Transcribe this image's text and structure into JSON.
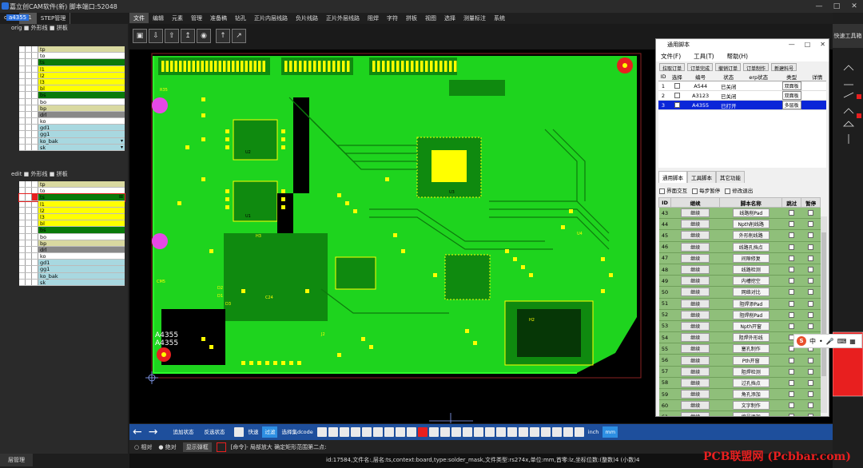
{
  "window": {
    "title": "嘉立创CAM软件(新) 脚本端口:52048",
    "controls": [
      "—",
      "□",
      "✕"
    ]
  },
  "left_panel": {
    "tabs": [
      "orig",
      "+1",
      "STEP管理"
    ],
    "step_name": "a4355",
    "orig_group": {
      "label": "orig",
      "options": [
        "外形线",
        "拼板"
      ]
    },
    "edit_group": {
      "label": "edit",
      "options": [
        "外形线",
        "拼板"
      ]
    },
    "orig_layers": [
      {
        "name": "tp",
        "color": "#d9d9a0"
      },
      {
        "name": "to",
        "color": "#ffffff"
      },
      {
        "name": "ts",
        "color": "#0a7a0a"
      },
      {
        "name": "l1",
        "color": "#ffff00"
      },
      {
        "name": "l2",
        "color": "#ffff00"
      },
      {
        "name": "l3",
        "color": "#ffff00"
      },
      {
        "name": "bl",
        "color": "#ffff00"
      },
      {
        "name": "bs",
        "color": "#0a7a0a"
      },
      {
        "name": "bo",
        "color": "#ffffff"
      },
      {
        "name": "bp",
        "color": "#d9d9a0"
      },
      {
        "name": "drl",
        "color": "#888888"
      },
      {
        "name": "ko",
        "color": "#ffffff"
      },
      {
        "name": "gd1",
        "color": "#a8d8e0"
      },
      {
        "name": "gg1",
        "color": "#a8d8e0"
      },
      {
        "name": "ko_bak",
        "color": "#a8d8e0",
        "dropdown": true
      },
      {
        "name": "sk",
        "color": "#a8d8e0",
        "dropdown": true
      }
    ],
    "edit_layers": [
      {
        "name": "tp",
        "color": "#d9d9a0"
      },
      {
        "name": "to",
        "color": "#ffffff"
      },
      {
        "name": "ts",
        "color": "#0a7a0a",
        "selected": true
      },
      {
        "name": "l1",
        "color": "#ffff00"
      },
      {
        "name": "l2",
        "color": "#ffff00"
      },
      {
        "name": "l3",
        "color": "#ffff00"
      },
      {
        "name": "bl",
        "color": "#ffff00"
      },
      {
        "name": "bs",
        "color": "#0a7a0a"
      },
      {
        "name": "bo",
        "color": "#ffffff"
      },
      {
        "name": "bp",
        "color": "#d9d9a0"
      },
      {
        "name": "drl",
        "color": "#888888"
      },
      {
        "name": "ko",
        "color": "#ffffff"
      },
      {
        "name": "gd1",
        "color": "#a8d8e0"
      },
      {
        "name": "gg1",
        "color": "#a8d8e0"
      },
      {
        "name": "ko_bak",
        "color": "#a8d8e0"
      },
      {
        "name": "sk",
        "color": "#a8d8e0"
      }
    ],
    "bottom_tab": "层管理"
  },
  "menu": [
    "文件",
    "编辑",
    "元素",
    "管理",
    "准备稿",
    "钻孔",
    "正片内层线路",
    "负片线路",
    "正片外层线路",
    "阻焊",
    "字符",
    "拼板",
    "视图",
    "选择",
    "测量标注",
    "系统"
  ],
  "quick_toolbar": "快速工具箱",
  "pcb": {
    "labels": [
      "A4355",
      "A4355",
      "R35",
      "H3",
      "U2",
      "U1",
      "U3",
      "C24",
      "J2",
      "CM5",
      "D1",
      "D2",
      "D3",
      "H2",
      "U4"
    ]
  },
  "dialog": {
    "title": "通用脚本",
    "menu": [
      "文件(F)",
      "工具(T)",
      "帮助(H)"
    ],
    "buttons": [
      "拉取订单",
      "订单完成",
      "撤销订单",
      "订单制作",
      "新建料号"
    ],
    "orders_header": [
      "ID",
      "选择",
      "编号",
      "状态",
      "erp状态",
      "类型",
      "详情"
    ],
    "orders": [
      {
        "id": "1",
        "code": "A544",
        "status": "已关闭",
        "erp": "",
        "type": "双面板"
      },
      {
        "id": "2",
        "code": "A3123",
        "status": "已关闭",
        "erp": "",
        "type": "双面板"
      },
      {
        "id": "3",
        "code": "A4355",
        "status": "已打开",
        "erp": "",
        "type": "多层板",
        "selected": true
      }
    ],
    "tabs": [
      "通用脚本",
      "工具脚本",
      "其它功能"
    ],
    "options": [
      "界面交互",
      "每步暂停",
      "修改退出"
    ],
    "steps_header": [
      "ID",
      "继续",
      "脚本名称",
      "跳过",
      "暂停"
    ],
    "steps": [
      {
        "id": "43",
        "btn": "继续",
        "name": "线路削Pad"
      },
      {
        "id": "44",
        "btn": "继续",
        "name": "Npth削线路"
      },
      {
        "id": "45",
        "btn": "继续",
        "name": "外形削线路"
      },
      {
        "id": "46",
        "btn": "继续",
        "name": "线路孔挡点"
      },
      {
        "id": "47",
        "btn": "继续",
        "name": "间隙修复"
      },
      {
        "id": "48",
        "btn": "继续",
        "name": "线路检测"
      },
      {
        "id": "49",
        "btn": "继续",
        "name": "内槽挖空"
      },
      {
        "id": "50",
        "btn": "继续",
        "name": "网络对比"
      },
      {
        "id": "51",
        "btn": "继续",
        "name": "阻焊添Pad"
      },
      {
        "id": "52",
        "btn": "继续",
        "name": "阻焊削Pad"
      },
      {
        "id": "53",
        "btn": "继续",
        "name": "Npth开窗"
      },
      {
        "id": "54",
        "btn": "继续",
        "name": "阻焊外形线"
      },
      {
        "id": "55",
        "btn": "继续",
        "name": "塞孔制作"
      },
      {
        "id": "56",
        "btn": "继续",
        "name": "Pth开窗"
      },
      {
        "id": "57",
        "btn": "继续",
        "name": "阻焊检测"
      },
      {
        "id": "58",
        "btn": "继续",
        "name": "过孔挡点"
      },
      {
        "id": "59",
        "btn": "继续",
        "name": "角孔添加"
      },
      {
        "id": "60",
        "btn": "继续",
        "name": "文字制作"
      },
      {
        "id": "61",
        "btn": "继续",
        "name": "编号添加"
      }
    ]
  },
  "bottom_toolbar": {
    "buttons": [
      "追加状态",
      "反选状态",
      "快速",
      "过滤",
      "选择集dcode",
      "inch",
      "mm"
    ],
    "highlight": "过滤"
  },
  "status": {
    "coord_modes": [
      "相对",
      "绝对"
    ],
    "show_btn": "显示弹框",
    "command": "[命令]- 局部放大 确定矩形范围第二点:",
    "info": "id:17584,文件名:,层名:ts,context:board,type:solder_mask,文件类型:rs274x,单位:mm,首零:lz,坐标位数:(整数)4 (小数)4"
  },
  "watermark": "PCB联盟网 (Pcbbar.com)",
  "ime": {
    "label": "中"
  }
}
